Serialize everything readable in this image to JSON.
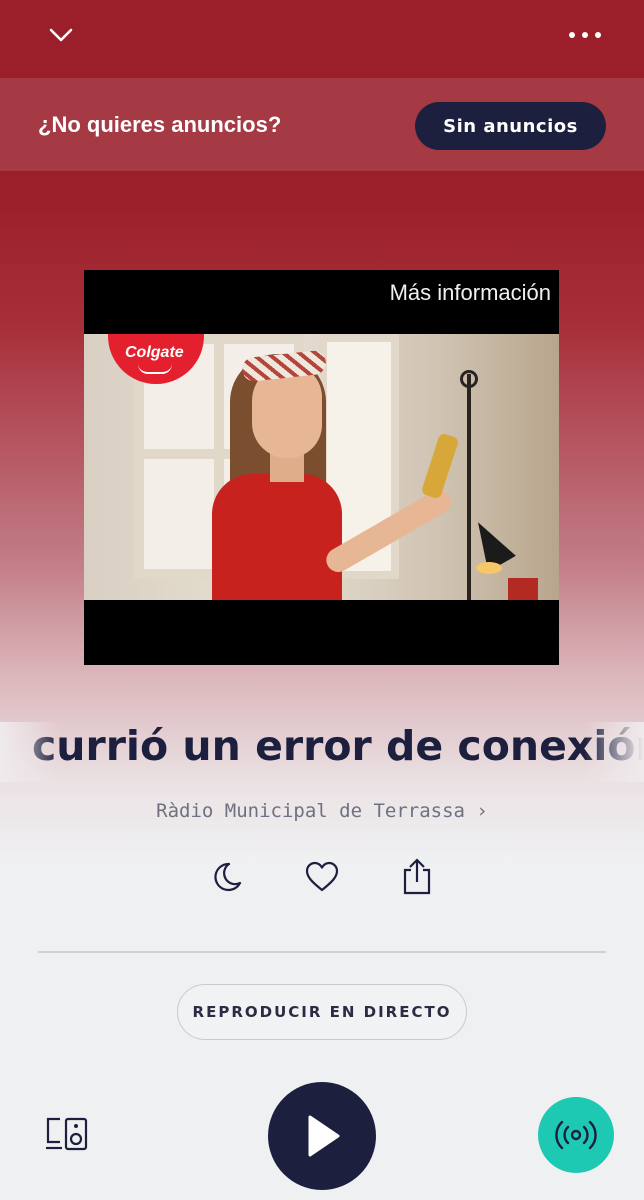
{
  "header": {
    "collapse_icon": "chevron-down-icon",
    "more_icon": "more-horizontal-icon"
  },
  "ad_banner": {
    "question": "¿No quieres anuncios?",
    "button_label": "Sin anuncios"
  },
  "video_ad": {
    "more_info": "Más información",
    "brand_logo_text": "Colgate"
  },
  "player": {
    "title": "currió un error de conexión",
    "station": "Ràdio Municipal de Terrassa ›",
    "actions": [
      {
        "name": "sleep-timer-icon"
      },
      {
        "name": "favorite-icon"
      },
      {
        "name": "share-icon"
      }
    ],
    "live_button": "REPRODUCIR EN DIRECTO"
  },
  "bottom_controls": {
    "cast_icon": "speaker-devices-icon",
    "play_icon": "play-icon",
    "live_icon": "live-broadcast-icon"
  },
  "colors": {
    "header_red": "#9b1f2a",
    "navy": "#1d1f3e",
    "teal": "#1ec9b3",
    "background": "#eff0f2"
  }
}
